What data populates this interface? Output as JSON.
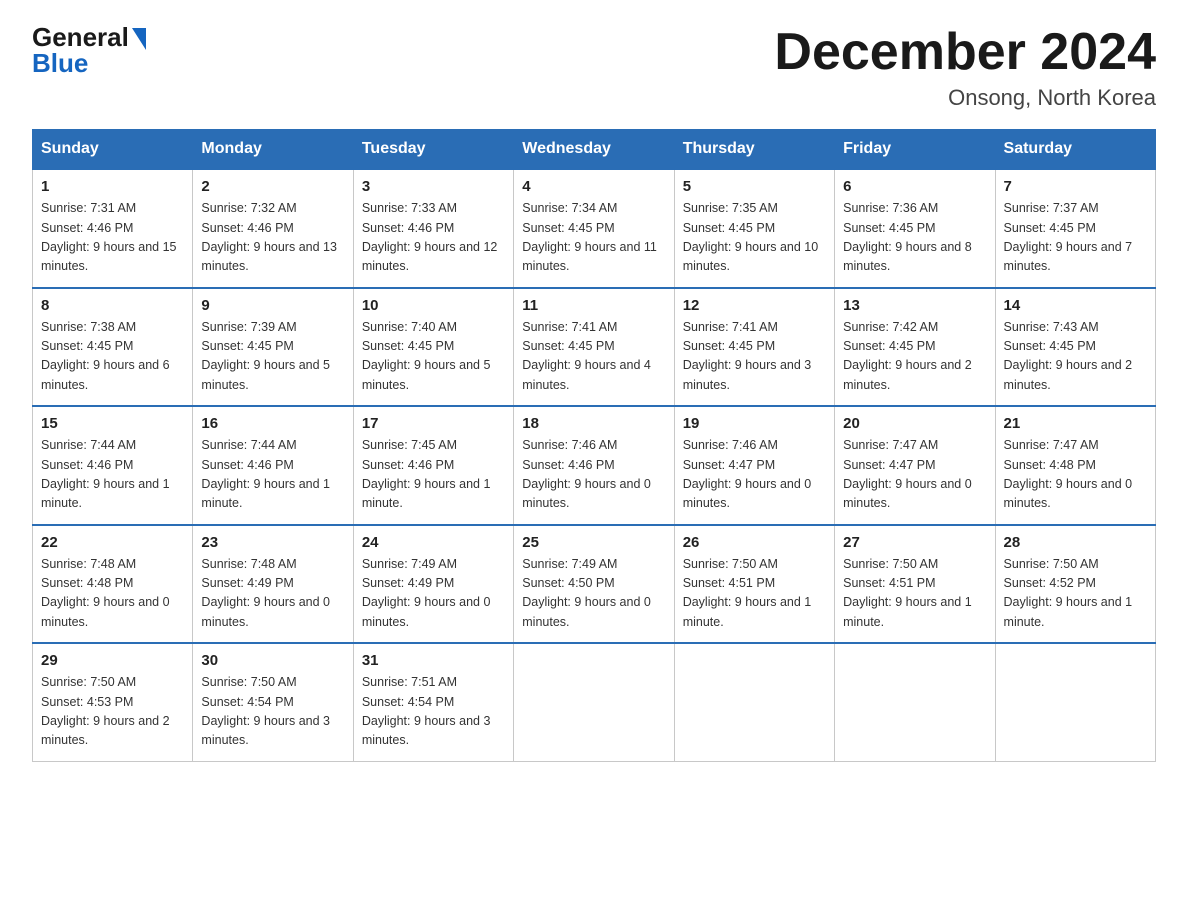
{
  "logo": {
    "general": "General",
    "blue": "Blue"
  },
  "title": "December 2024",
  "location": "Onsong, North Korea",
  "days_of_week": [
    "Sunday",
    "Monday",
    "Tuesday",
    "Wednesday",
    "Thursday",
    "Friday",
    "Saturday"
  ],
  "weeks": [
    [
      {
        "day": "1",
        "sunrise": "7:31 AM",
        "sunset": "4:46 PM",
        "daylight": "9 hours and 15 minutes."
      },
      {
        "day": "2",
        "sunrise": "7:32 AM",
        "sunset": "4:46 PM",
        "daylight": "9 hours and 13 minutes."
      },
      {
        "day": "3",
        "sunrise": "7:33 AM",
        "sunset": "4:46 PM",
        "daylight": "9 hours and 12 minutes."
      },
      {
        "day": "4",
        "sunrise": "7:34 AM",
        "sunset": "4:45 PM",
        "daylight": "9 hours and 11 minutes."
      },
      {
        "day": "5",
        "sunrise": "7:35 AM",
        "sunset": "4:45 PM",
        "daylight": "9 hours and 10 minutes."
      },
      {
        "day": "6",
        "sunrise": "7:36 AM",
        "sunset": "4:45 PM",
        "daylight": "9 hours and 8 minutes."
      },
      {
        "day": "7",
        "sunrise": "7:37 AM",
        "sunset": "4:45 PM",
        "daylight": "9 hours and 7 minutes."
      }
    ],
    [
      {
        "day": "8",
        "sunrise": "7:38 AM",
        "sunset": "4:45 PM",
        "daylight": "9 hours and 6 minutes."
      },
      {
        "day": "9",
        "sunrise": "7:39 AM",
        "sunset": "4:45 PM",
        "daylight": "9 hours and 5 minutes."
      },
      {
        "day": "10",
        "sunrise": "7:40 AM",
        "sunset": "4:45 PM",
        "daylight": "9 hours and 5 minutes."
      },
      {
        "day": "11",
        "sunrise": "7:41 AM",
        "sunset": "4:45 PM",
        "daylight": "9 hours and 4 minutes."
      },
      {
        "day": "12",
        "sunrise": "7:41 AM",
        "sunset": "4:45 PM",
        "daylight": "9 hours and 3 minutes."
      },
      {
        "day": "13",
        "sunrise": "7:42 AM",
        "sunset": "4:45 PM",
        "daylight": "9 hours and 2 minutes."
      },
      {
        "day": "14",
        "sunrise": "7:43 AM",
        "sunset": "4:45 PM",
        "daylight": "9 hours and 2 minutes."
      }
    ],
    [
      {
        "day": "15",
        "sunrise": "7:44 AM",
        "sunset": "4:46 PM",
        "daylight": "9 hours and 1 minute."
      },
      {
        "day": "16",
        "sunrise": "7:44 AM",
        "sunset": "4:46 PM",
        "daylight": "9 hours and 1 minute."
      },
      {
        "day": "17",
        "sunrise": "7:45 AM",
        "sunset": "4:46 PM",
        "daylight": "9 hours and 1 minute."
      },
      {
        "day": "18",
        "sunrise": "7:46 AM",
        "sunset": "4:46 PM",
        "daylight": "9 hours and 0 minutes."
      },
      {
        "day": "19",
        "sunrise": "7:46 AM",
        "sunset": "4:47 PM",
        "daylight": "9 hours and 0 minutes."
      },
      {
        "day": "20",
        "sunrise": "7:47 AM",
        "sunset": "4:47 PM",
        "daylight": "9 hours and 0 minutes."
      },
      {
        "day": "21",
        "sunrise": "7:47 AM",
        "sunset": "4:48 PM",
        "daylight": "9 hours and 0 minutes."
      }
    ],
    [
      {
        "day": "22",
        "sunrise": "7:48 AM",
        "sunset": "4:48 PM",
        "daylight": "9 hours and 0 minutes."
      },
      {
        "day": "23",
        "sunrise": "7:48 AM",
        "sunset": "4:49 PM",
        "daylight": "9 hours and 0 minutes."
      },
      {
        "day": "24",
        "sunrise": "7:49 AM",
        "sunset": "4:49 PM",
        "daylight": "9 hours and 0 minutes."
      },
      {
        "day": "25",
        "sunrise": "7:49 AM",
        "sunset": "4:50 PM",
        "daylight": "9 hours and 0 minutes."
      },
      {
        "day": "26",
        "sunrise": "7:50 AM",
        "sunset": "4:51 PM",
        "daylight": "9 hours and 1 minute."
      },
      {
        "day": "27",
        "sunrise": "7:50 AM",
        "sunset": "4:51 PM",
        "daylight": "9 hours and 1 minute."
      },
      {
        "day": "28",
        "sunrise": "7:50 AM",
        "sunset": "4:52 PM",
        "daylight": "9 hours and 1 minute."
      }
    ],
    [
      {
        "day": "29",
        "sunrise": "7:50 AM",
        "sunset": "4:53 PM",
        "daylight": "9 hours and 2 minutes."
      },
      {
        "day": "30",
        "sunrise": "7:50 AM",
        "sunset": "4:54 PM",
        "daylight": "9 hours and 3 minutes."
      },
      {
        "day": "31",
        "sunrise": "7:51 AM",
        "sunset": "4:54 PM",
        "daylight": "9 hours and 3 minutes."
      },
      null,
      null,
      null,
      null
    ]
  ]
}
